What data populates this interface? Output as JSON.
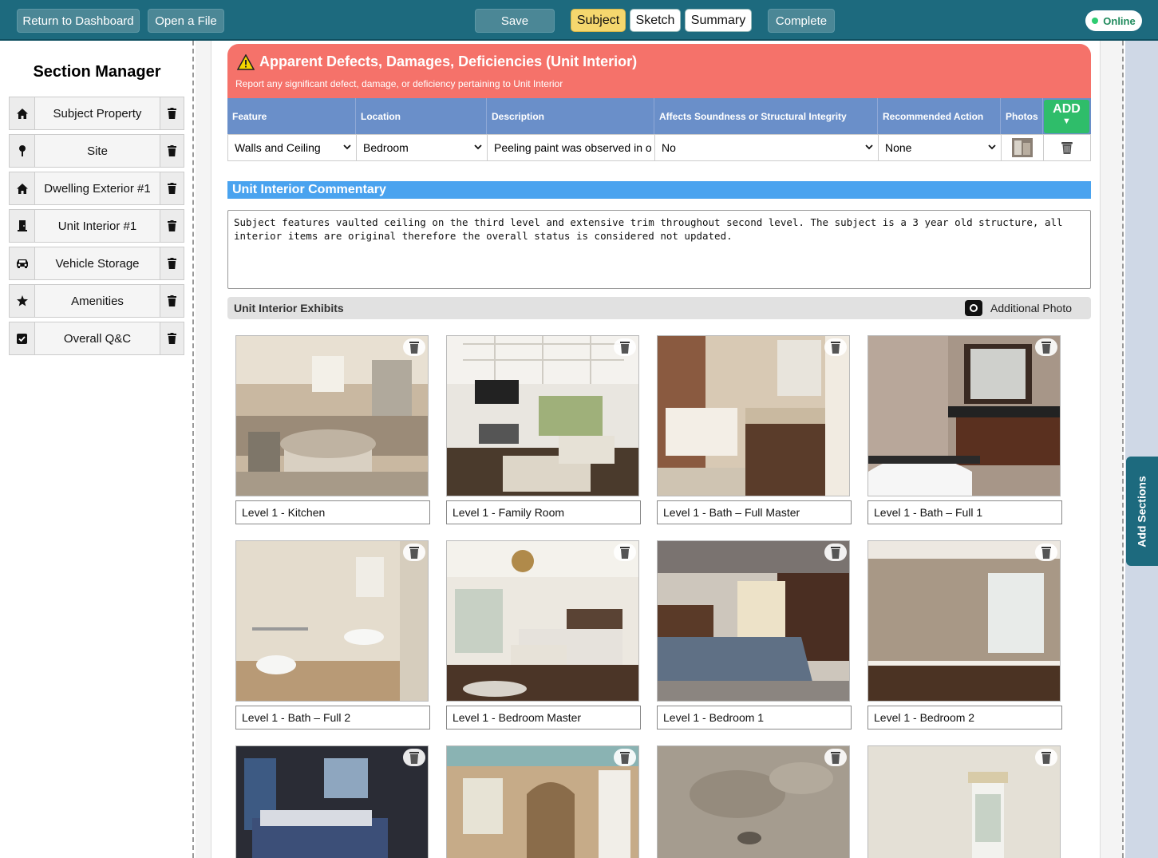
{
  "toolbar": {
    "return_label": "Return to Dashboard",
    "open_label": "Open a File",
    "save_label": "Save",
    "tabs": [
      "Subject",
      "Sketch",
      "Summary"
    ],
    "complete_label": "Complete",
    "status": "Online"
  },
  "sidebar": {
    "title": "Section Manager",
    "items": [
      {
        "label": "Subject Property",
        "icon": "home-icon"
      },
      {
        "label": "Site",
        "icon": "pin-icon"
      },
      {
        "label": "Dwelling Exterior #1",
        "icon": "home-icon"
      },
      {
        "label": "Unit Interior #1",
        "icon": "door-icon"
      },
      {
        "label": "Vehicle Storage",
        "icon": "car-icon"
      },
      {
        "label": "Amenities",
        "icon": "star-icon"
      },
      {
        "label": "Overall Q&C",
        "icon": "checkbox-icon"
      }
    ]
  },
  "defects": {
    "title": "Apparent Defects, Damages, Deficiencies (Unit Interior)",
    "subtitle": "Report any significant defect, damage, or deficiency pertaining to Unit Interior",
    "columns": [
      "Feature",
      "Location",
      "Description",
      "Affects Soundness or Structural Integrity",
      "Recommended Action",
      "Photos"
    ],
    "add_label": "ADD",
    "row": {
      "feature": "Walls and Ceiling",
      "location": "Bedroom",
      "description": "Peeling paint was observed in o",
      "affects": "No",
      "action": "None"
    }
  },
  "commentary": {
    "title": "Unit Interior Commentary",
    "text": "Subject features vaulted ceiling on the third level and extensive trim throughout second level. The subject is a 3 year old structure, all interior items are original therefore the overall status is considered not updated."
  },
  "exhibits": {
    "title": "Unit Interior Exhibits",
    "add_photo_label": "Additional Photo",
    "photos": [
      {
        "caption": "Level 1 - Kitchen"
      },
      {
        "caption": "Level 1 - Family Room"
      },
      {
        "caption": "Level 1 - Bath – Full Master"
      },
      {
        "caption": "Level 1 - Bath – Full 1"
      },
      {
        "caption": "Level 1 - Bath – Full 2"
      },
      {
        "caption": "Level 1 - Bedroom Master"
      },
      {
        "caption": "Level 1 - Bedroom 1"
      },
      {
        "caption": "Level 1 - Bedroom 2"
      },
      {
        "caption": ""
      },
      {
        "caption": ""
      },
      {
        "caption": ""
      },
      {
        "caption": ""
      }
    ]
  },
  "right_rail": {
    "add_sections_label": "Add Sections"
  },
  "colors": {
    "topbar": "#1d6a7e",
    "active_tab": "#f5d76e",
    "defects_header": "#f5726a",
    "table_header": "#6a8fc9",
    "add_button": "#2fbd6a",
    "commentary_header": "#4aa3ef"
  }
}
